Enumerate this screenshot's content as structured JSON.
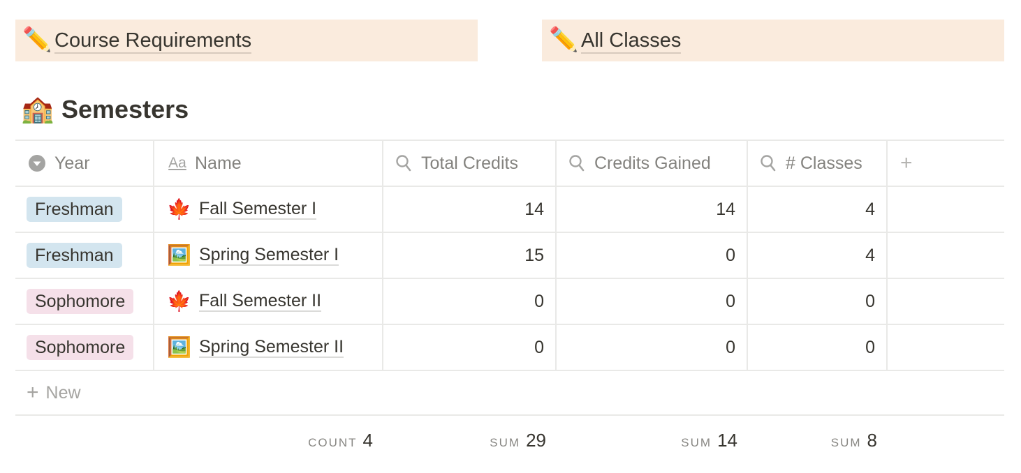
{
  "callouts": [
    {
      "icon": "pencil-icon",
      "emoji": "✏️",
      "label": "Course Requirements"
    },
    {
      "icon": "pencil-icon",
      "emoji": "✏️",
      "label": "All Classes"
    }
  ],
  "database": {
    "icon": "school-icon",
    "emoji": "🏫",
    "title": "Semesters"
  },
  "columns": [
    {
      "key": "year",
      "label": "Year",
      "icon": "select-icon"
    },
    {
      "key": "name",
      "label": "Name",
      "icon": "text-property-icon",
      "glyph": "Aa"
    },
    {
      "key": "total_credits",
      "label": "Total Credits",
      "icon": "rollup-search-icon"
    },
    {
      "key": "credits_gained",
      "label": "Credits Gained",
      "icon": "rollup-search-icon"
    },
    {
      "key": "classes",
      "label": "# Classes",
      "icon": "rollup-search-icon"
    }
  ],
  "add_column_label": "+",
  "rows": [
    {
      "year": "Freshman",
      "year_color": "#d3e5ef",
      "emoji": "🍁",
      "name": "Fall Semester I",
      "total_credits": "14",
      "credits_gained": "14",
      "classes": "4"
    },
    {
      "year": "Freshman",
      "year_color": "#d3e5ef",
      "emoji": "🖼️",
      "name": "Spring Semester I",
      "total_credits": "15",
      "credits_gained": "0",
      "classes": "4"
    },
    {
      "year": "Sophomore",
      "year_color": "#f5e0e9",
      "emoji": "🍁",
      "name": "Fall Semester II",
      "total_credits": "0",
      "credits_gained": "0",
      "classes": "0"
    },
    {
      "year": "Sophomore",
      "year_color": "#f5e0e9",
      "emoji": "🖼️",
      "name": "Spring Semester II",
      "total_credits": "0",
      "credits_gained": "0",
      "classes": "0"
    }
  ],
  "new_row": {
    "plus": "+",
    "label": "New"
  },
  "aggregations": {
    "name": {
      "label": "COUNT",
      "value": "4"
    },
    "total_credits": {
      "label": "SUM",
      "value": "29"
    },
    "credits_gained": {
      "label": "SUM",
      "value": "14"
    },
    "classes": {
      "label": "SUM",
      "value": "8"
    }
  },
  "colors": {
    "callout_bg": "#faebdd",
    "tag_blue": "#d3e5ef",
    "tag_pink": "#f5e0e9",
    "text": "#37352f"
  }
}
